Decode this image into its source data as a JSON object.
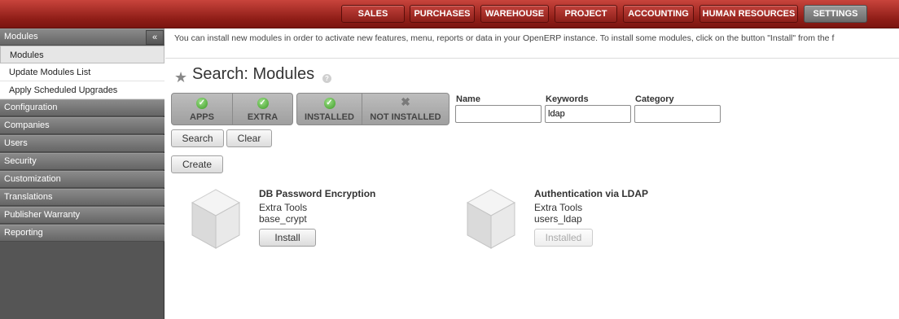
{
  "topbar": {
    "menus": [
      "SALES",
      "PURCHASES",
      "WAREHOUSE",
      "PROJECT",
      "ACCOUNTING",
      "HUMAN RESOURCES",
      "SETTINGS"
    ],
    "active": "SETTINGS"
  },
  "sidebar": {
    "collapse_icon": "«",
    "sections": [
      {
        "label": "Modules"
      },
      {
        "label": "Configuration"
      },
      {
        "label": "Companies"
      },
      {
        "label": "Users"
      },
      {
        "label": "Security"
      },
      {
        "label": "Customization"
      },
      {
        "label": "Translations"
      },
      {
        "label": "Publisher Warranty"
      },
      {
        "label": "Reporting"
      }
    ],
    "sub_items": [
      "Modules",
      "Update Modules List",
      "Apply Scheduled Upgrades"
    ]
  },
  "main": {
    "info_text": "You can install new modules in order to activate new features, menu, reports or data in your OpenERP instance. To install some modules, click on the button \"Install\" from the f",
    "title": "Search: Modules",
    "help": "?",
    "filters": {
      "group1": [
        "APPS",
        "EXTRA"
      ],
      "group2": [
        "INSTALLED",
        "NOT INSTALLED"
      ]
    },
    "fields": {
      "name_label": "Name",
      "keywords_label": "Keywords",
      "keywords_value": "ldap",
      "category_label": "Category"
    },
    "buttons": {
      "search": "Search",
      "clear": "Clear",
      "create": "Create"
    },
    "modules": [
      {
        "title": "DB Password Encryption",
        "category": "Extra Tools",
        "technical": "base_crypt",
        "action": "Install"
      },
      {
        "title": "Authentication via LDAP",
        "category": "Extra Tools",
        "technical": "users_ldap",
        "action": "Installed"
      }
    ]
  },
  "colors": {
    "topbar": "#a02a22",
    "sidebar": "#555555",
    "check": "#3a9a22"
  }
}
